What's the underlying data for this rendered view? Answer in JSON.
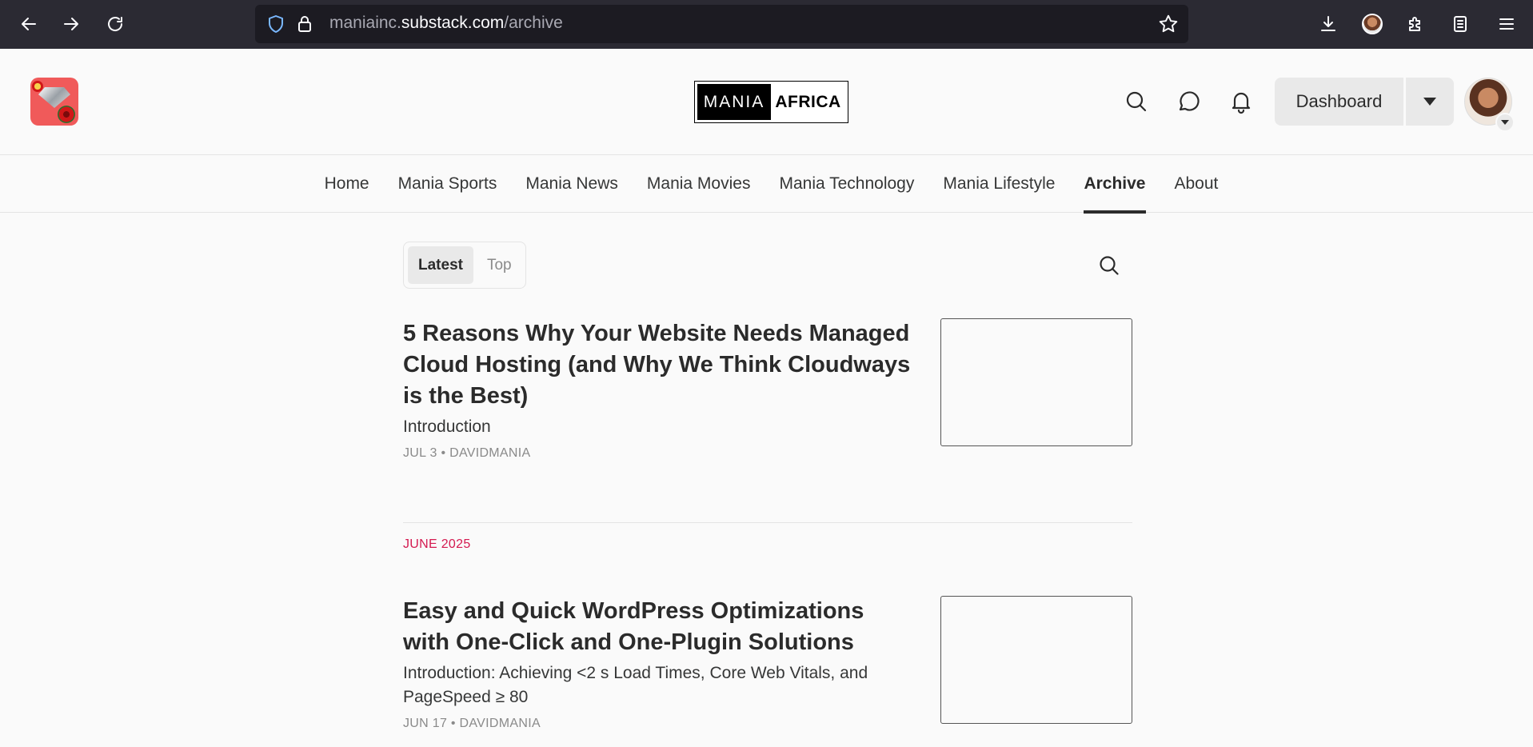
{
  "browser": {
    "url_prefix": "maniainc.",
    "url_domain": "substack.com",
    "url_path": "/archive"
  },
  "header": {
    "masthead_left": "MANIA",
    "masthead_right": "AFRICA",
    "dashboard_label": "Dashboard"
  },
  "nav": {
    "items": [
      {
        "label": "Home"
      },
      {
        "label": "Mania Sports"
      },
      {
        "label": "Mania News"
      },
      {
        "label": "Mania Movies"
      },
      {
        "label": "Mania Technology"
      },
      {
        "label": "Mania Lifestyle"
      },
      {
        "label": "Archive",
        "active": true
      },
      {
        "label": "About"
      }
    ]
  },
  "tabs": {
    "latest": "Latest",
    "top": "Top"
  },
  "posts": [
    {
      "title": "5 Reasons Why Your Website Needs Managed Cloud Hosting (and Why We Think Cloudways is the Best)",
      "subtitle": "Introduction",
      "meta": "JUL 3 • DAVIDMANIA"
    },
    {
      "title": "Easy and Quick WordPress Optimizations with One-Click and One-Plugin Solutions",
      "subtitle": "Introduction: Achieving <2 s Load Times, Core Web Vitals, and PageSpeed ≥ 80",
      "meta": "JUN 17 • DAVIDMANIA"
    }
  ],
  "month_label": "JUNE 2025",
  "colors": {
    "accent": "#d41a50",
    "browser_chrome": "#2b2a33",
    "page_bg": "#fafafa"
  }
}
